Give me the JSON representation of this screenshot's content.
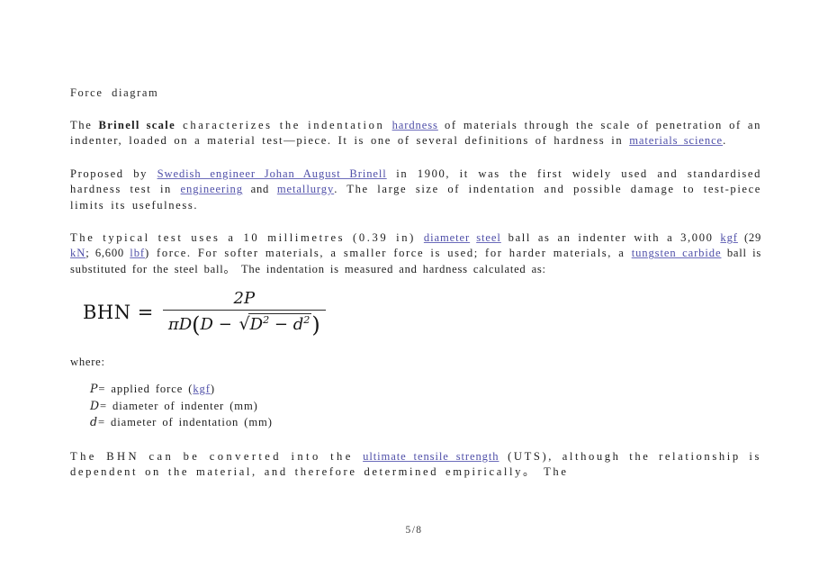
{
  "document": {
    "heading": "Force  diagram",
    "footer": "5/8",
    "link_color": "#4f4fa8",
    "text_color": "#1d1d1d"
  },
  "paragraph1": {
    "p1_a": "The ",
    "p1_bold": "Brinell scale",
    "p1_b": " characterizes  the  indentation ",
    "p1_link1": "hardness",
    "p1_c": " of materials through the scale of penetration of  an  indenter,   loaded on a material test—piece.  It is one of  several definitions of hardness in ",
    "p1_link2": "materials science",
    "p1_d": "."
  },
  "paragraph2": {
    "p2_a": "Proposed by ",
    "p2_link1": "Swedish engineer Johan August Brinell",
    "p2_b": " in  1900, it  was the  first  widely used and standardised hardness test  in ",
    "p2_link2": "engineering",
    "p2_c": " and ",
    "p2_link3": "metallurgy",
    "p2_d": ". The large  size of indentation and possible damage to  test-piece limits its usefulness."
  },
  "paragraph3": {
    "p3_a": "The  typical test uses  a 10  millimetres  (0.39  in) ",
    "p3_link1": "diameter",
    "p3_b": " ",
    "p3_link2": "steel",
    "p3_c": " ball as  an indenter with  a  3,000 ",
    "p3_link3": "kgf",
    "p3_d": "  (29 ",
    "p3_link4": "kN",
    "p3_e": "; 6,600 ",
    "p3_link5": "lbf",
    "p3_f": ")  force. For softer materials,  a smaller force is used; for harder materials,  a ",
    "p3_link6": "tungsten carbide",
    "p3_g": " ball is substituted for  the steel ball。 The indentation is measured and hardness calculated as:"
  },
  "formula": {
    "lhs": "BHN =",
    "numerator": "2P",
    "denominator_prefix": "πD",
    "denominator_open": "(",
    "denominator_first": "D −",
    "radical_sign": "√",
    "radicand_d_big": "D",
    "radicand_exp1": "2",
    "radicand_minus": " − ",
    "radicand_d_small": "d",
    "radicand_exp2": "2",
    "denominator_close": ")"
  },
  "where": {
    "label": "where:",
    "items": [
      {
        "symbol": "P",
        "equals": "= applied force   (",
        "link": "kgf",
        "after": ")"
      },
      {
        "symbol": "D",
        "equals": "= diameter of indenter   (mm)",
        "link": "",
        "after": ""
      },
      {
        "symbol": "d",
        "equals": "= diameter of indentation   (mm)",
        "link": "",
        "after": ""
      }
    ]
  },
  "paragraph4": {
    "p4_a": "The  BHN  can  be  converted  into  the ",
    "p4_link1": "ultimate tensile strength",
    "p4_b": " (UTS),  although  the relationship  is  dependent  on  the  material,  and  therefore determined  empirically。  The"
  }
}
